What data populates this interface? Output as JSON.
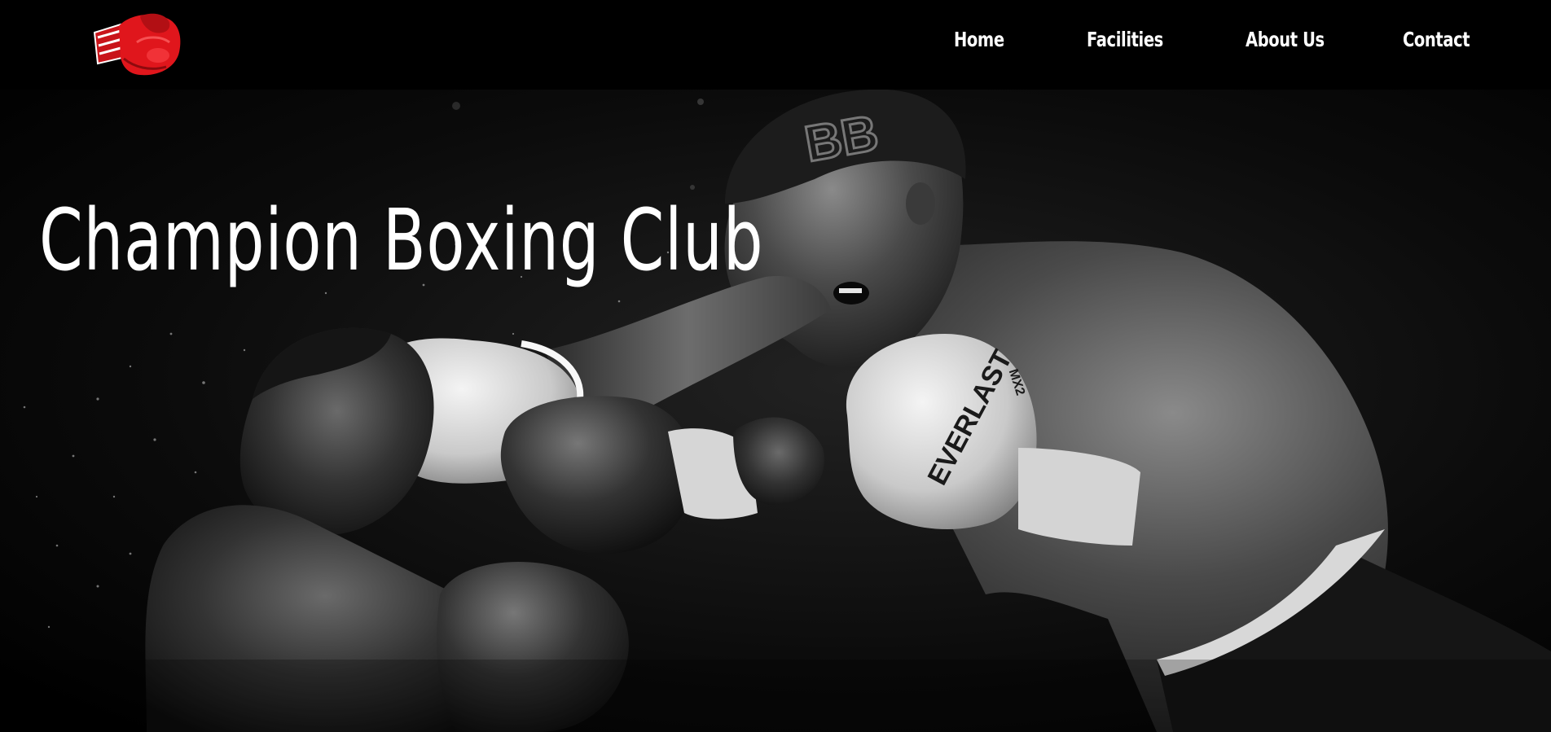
{
  "header": {
    "logo": {
      "icon": "boxing-glove-icon",
      "color": "#d9141b"
    },
    "nav": {
      "items": [
        {
          "label": "Home"
        },
        {
          "label": "Facilities"
        },
        {
          "label": "About Us"
        },
        {
          "label": "Contact"
        }
      ]
    }
  },
  "hero": {
    "title": "Champion Boxing Club",
    "image": {
      "subject": "black-and-white boxing match photo",
      "glove_brand": "EVERLAST",
      "glove_model": "MX2"
    }
  },
  "colors": {
    "background": "#000000",
    "text": "#ffffff",
    "accent": "#d9141b"
  }
}
